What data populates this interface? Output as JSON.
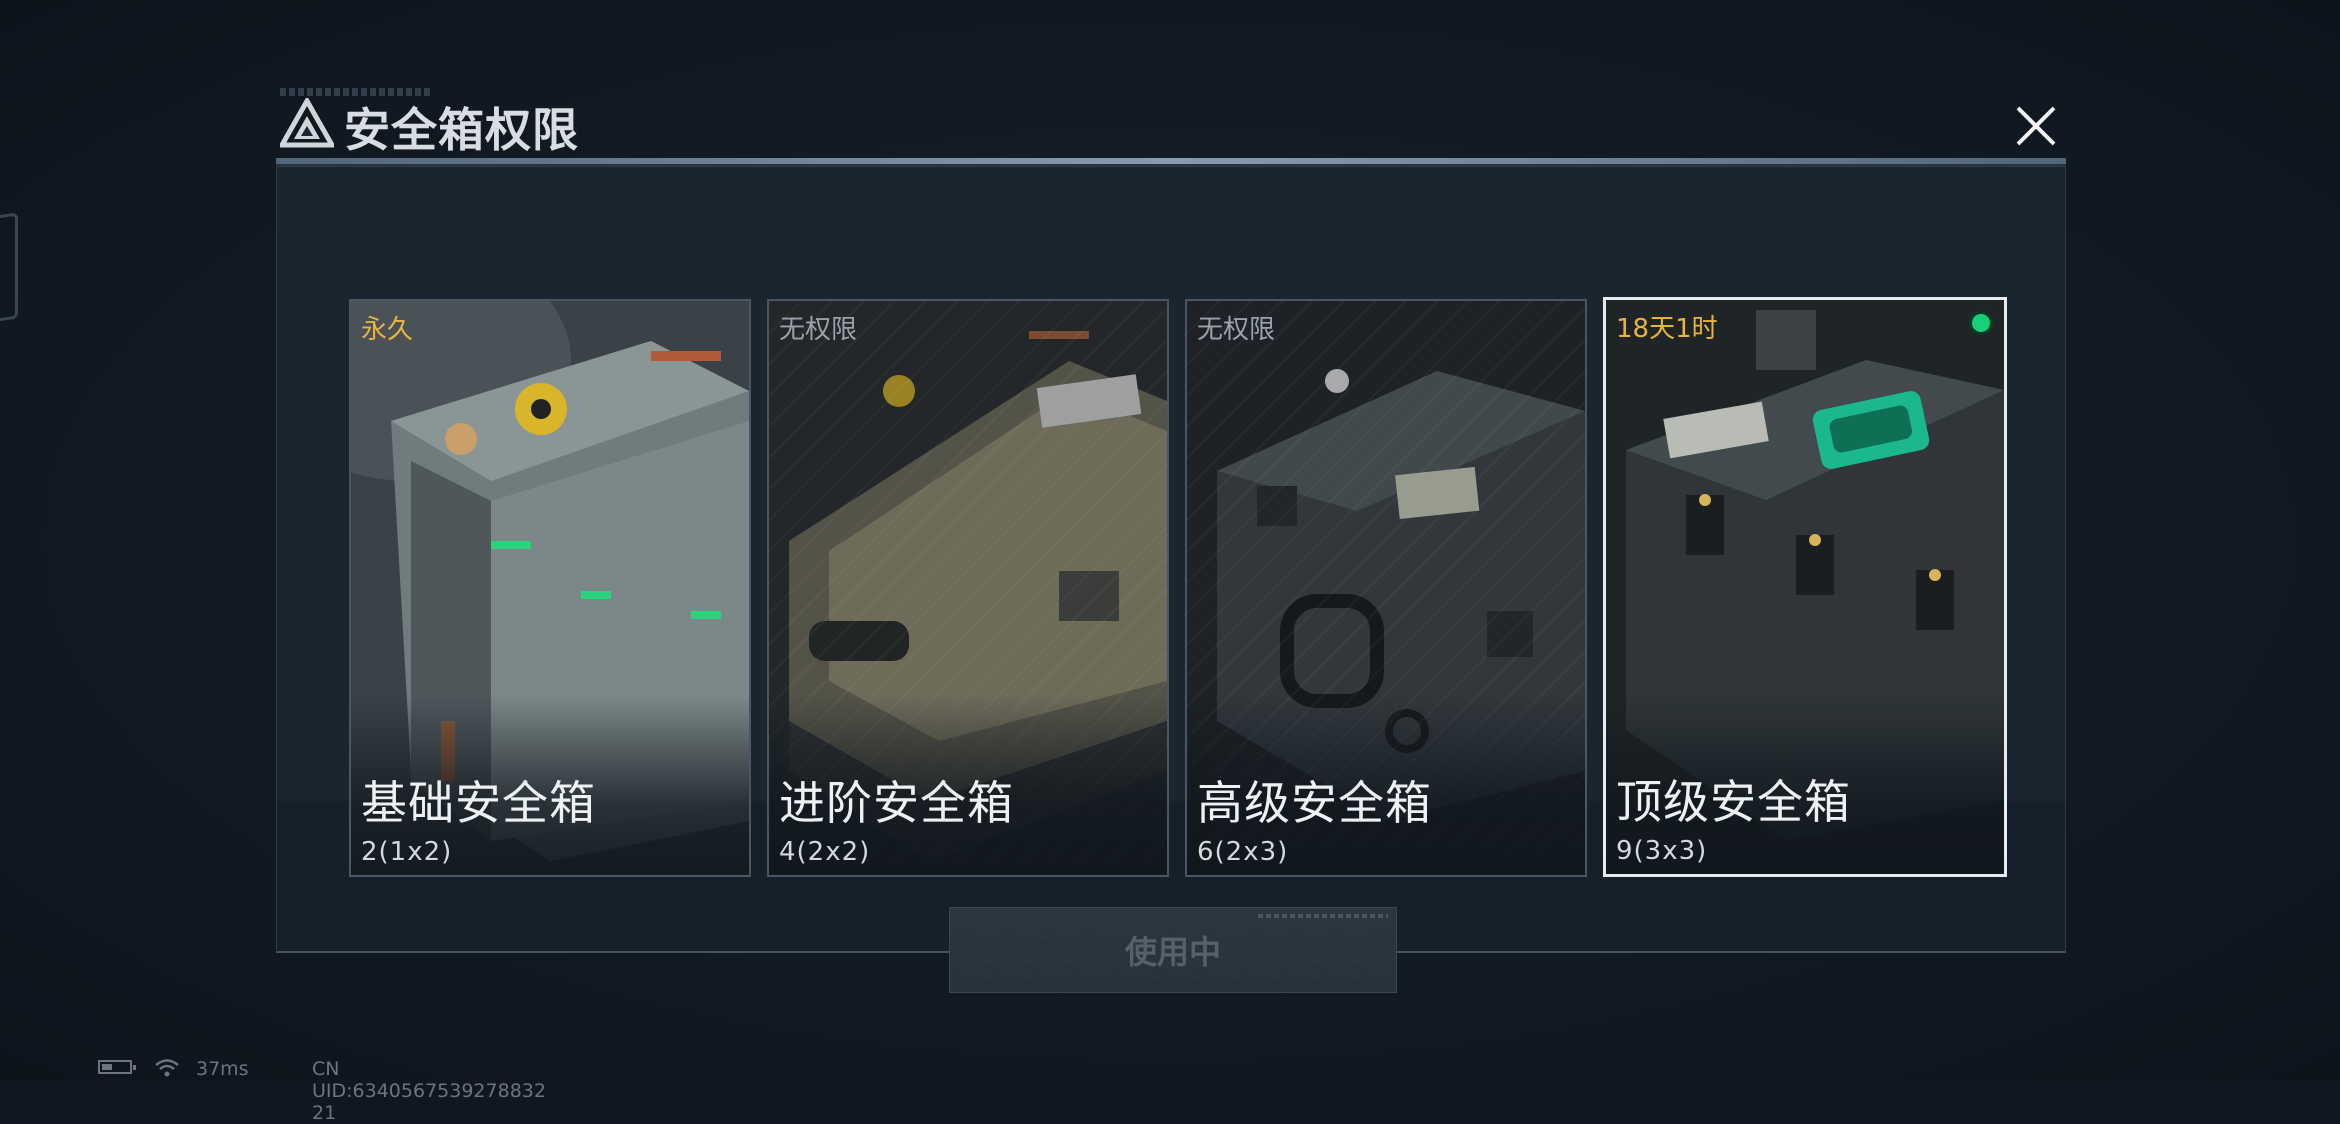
{
  "dialog": {
    "title": "安全箱权限",
    "close_icon": "close-x-icon",
    "use_button_label": "使用中"
  },
  "cards": [
    {
      "status": "永久",
      "status_color": "#e8b43c",
      "name": "基础安全箱",
      "capacity": "2(1x2)",
      "locked": false,
      "selected": false
    },
    {
      "status": "无权限",
      "status_color": "#9aa3ab",
      "name": "进阶安全箱",
      "capacity": "4(2x2)",
      "locked": true,
      "selected": false
    },
    {
      "status": "无权限",
      "status_color": "#9aa3ab",
      "name": "高级安全箱",
      "capacity": "6(2x3)",
      "locked": true,
      "selected": false
    },
    {
      "status": "18天1时",
      "status_color": "#e8b43c",
      "name": "顶级安全箱",
      "capacity": "9(3x3)",
      "locked": false,
      "selected": true,
      "active_indicator": "green-dot-icon"
    }
  ],
  "statusbar": {
    "ping": "37ms",
    "uid": "CN UID:6340567539278832​21"
  },
  "colors": {
    "accent_gold": "#e8b43c",
    "active_green": "#19d07a",
    "background": "#0f1721"
  }
}
